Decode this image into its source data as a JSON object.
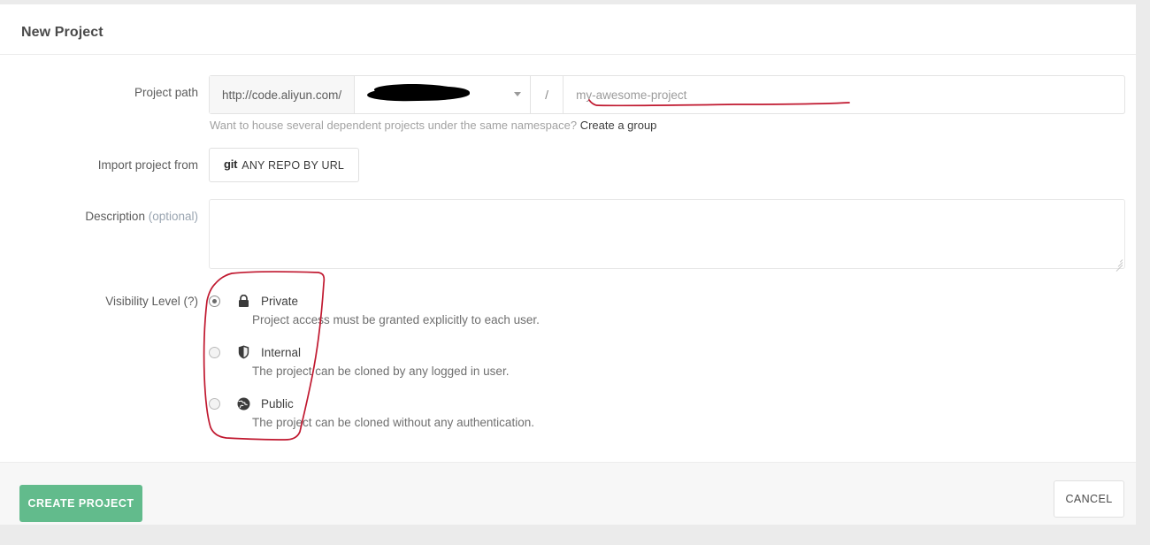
{
  "card": {
    "title": "New Project"
  },
  "project_path": {
    "label": "Project path",
    "prefix": "http://code.aliyun.com/",
    "namespace_value": "",
    "namespace_redacted": true,
    "separator": "/",
    "name_value": "",
    "name_placeholder": "my-awesome-project",
    "caret_icon": "chevron-down-icon",
    "help_text": "Want to house several dependent projects under the same namespace?",
    "help_link": "Create a group"
  },
  "import": {
    "label": "Import project from",
    "button_mark": "git",
    "button_label": "ANY REPO BY URL"
  },
  "description": {
    "label": "Description",
    "label_optional": "(optional)",
    "value": "",
    "placeholder": ""
  },
  "visibility": {
    "label": "Visibility Level (?)",
    "selected": "private",
    "options": [
      {
        "id": "private",
        "icon": "lock-icon",
        "name": "Private",
        "description": "Project access must be granted explicitly to each user.",
        "checked": true
      },
      {
        "id": "internal",
        "icon": "shield-icon",
        "name": "Internal",
        "description": "The project can be cloned by any logged in user.",
        "checked": false
      },
      {
        "id": "public",
        "icon": "globe-icon",
        "name": "Public",
        "description": "The project can be cloned without any authentication.",
        "checked": false
      }
    ]
  },
  "footer": {
    "create_label": "CREATE PROJECT",
    "cancel_label": "CANCEL"
  },
  "colors": {
    "page_background": "#ebebeb",
    "card_background": "#ffffff",
    "footer_background": "#f7f7f7",
    "create_button": "#62bb8c",
    "annotation_red": "#c0182f",
    "redaction_black": "#000000",
    "text_primary": "#4a4a4a",
    "text_muted": "#a2a2a2"
  },
  "annotations": [
    {
      "name": "underline-project-name",
      "type": "hand-drawn-underline",
      "color": "#c0182f"
    },
    {
      "name": "circle-visibility-options",
      "type": "hand-drawn-circle",
      "color": "#c0182f"
    },
    {
      "name": "namespace-redaction",
      "type": "brush-redaction",
      "color": "#000000"
    }
  ]
}
